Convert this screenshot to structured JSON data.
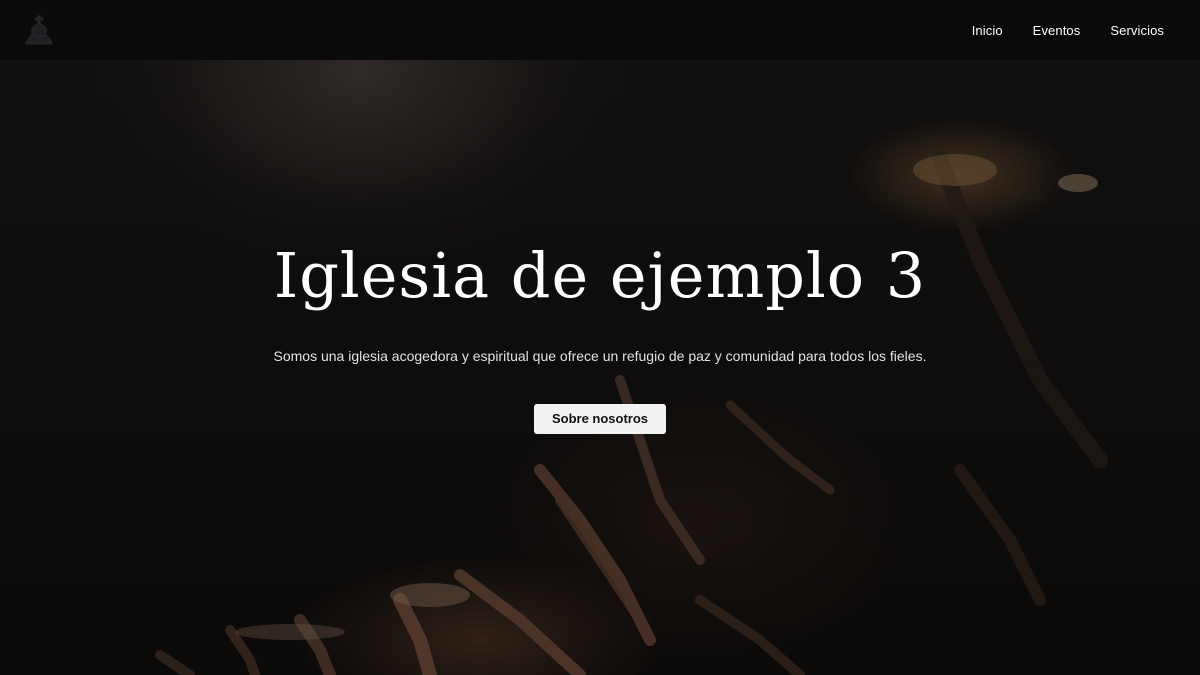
{
  "header": {
    "logo_icon": "church-icon",
    "nav": [
      {
        "label": "Inicio"
      },
      {
        "label": "Eventos"
      },
      {
        "label": "Servicios"
      }
    ]
  },
  "hero": {
    "title": "Iglesia de ejemplo 3",
    "subtitle": "Somos una iglesia acogedora y espiritual que ofrece un refugio de paz y comunidad para todos los fieles.",
    "button_label": "Sobre nosotros",
    "background": "worship-crowd-raised-hands-photo"
  },
  "colors": {
    "header_bg": "#0a0a0b",
    "text": "#ffffff",
    "button_bg": "#f3f3f3",
    "button_text": "#111111"
  }
}
